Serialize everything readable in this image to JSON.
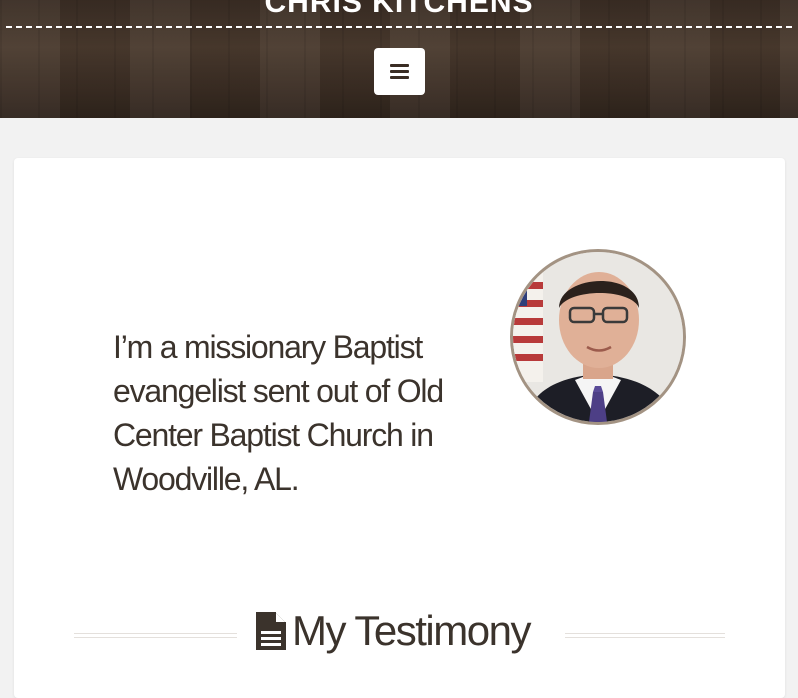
{
  "header": {
    "site_title": "CHRIS KITCHENS",
    "menu_icon": "hamburger-menu-icon"
  },
  "intro": {
    "text": "I’m a missionary Baptist evangelist sent out of Old Center Baptist Church in Woodville, AL."
  },
  "testimony": {
    "icon": "document-icon",
    "heading": "My Testimony"
  },
  "colors": {
    "header_wood": "#3d2f25",
    "text": "#3b332c",
    "avatar_border": "#a39383",
    "page_bg": "#f2f2f2"
  }
}
